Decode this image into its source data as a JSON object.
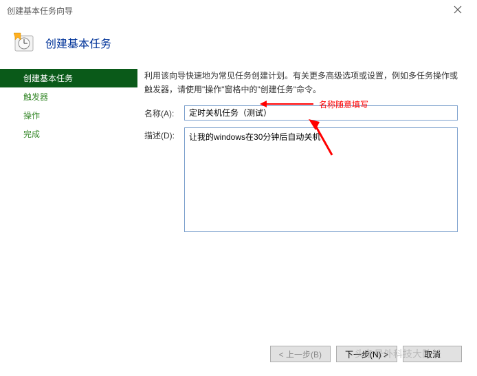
{
  "window": {
    "title": "创建基本任务向导"
  },
  "header": {
    "title": "创建基本任务"
  },
  "sidebar": {
    "items": [
      {
        "label": "创建基本任务",
        "active": true
      },
      {
        "label": "触发器",
        "active": false
      },
      {
        "label": "操作",
        "active": false
      },
      {
        "label": "完成",
        "active": false
      }
    ]
  },
  "main": {
    "intro": "利用该向导快速地为常见任务创建计划。有关更多高级选项或设置，例如多任务操作或触发器，请使用\"操作\"窗格中的\"创建任务\"命令。",
    "name_label": "名称(A):",
    "name_value": "定时关机任务（测试）",
    "desc_label": "描述(D):",
    "desc_value": "让我的windows在30分钟后自动关机"
  },
  "annotation": {
    "note": "名称随意填写"
  },
  "buttons": {
    "back": "< 上一步(B)",
    "next": "下一步(N) >",
    "cancel": "取消"
  },
  "watermark": "头条号外科技大队长"
}
